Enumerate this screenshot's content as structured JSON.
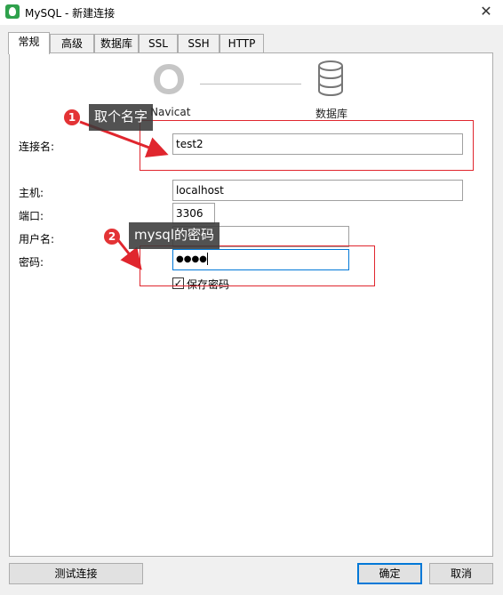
{
  "window": {
    "title": "MySQL - 新建连接",
    "close_glyph": "✕"
  },
  "tabs": [
    {
      "label": "常规",
      "active": true
    },
    {
      "label": "高级"
    },
    {
      "label": "数据库"
    },
    {
      "label": "SSL"
    },
    {
      "label": "SSH"
    },
    {
      "label": "HTTP"
    }
  ],
  "graphic": {
    "client_label": "Navicat",
    "server_label": "数据库",
    "client_icon": "navicat-icon",
    "server_icon": "database-icon"
  },
  "form": {
    "connection_name": {
      "label": "连接名:",
      "value": "test2"
    },
    "host": {
      "label": "主机:",
      "value": "localhost"
    },
    "port": {
      "label": "端口:",
      "value": "3306"
    },
    "username": {
      "label": "用户名:",
      "value": ""
    },
    "password": {
      "label": "密码:",
      "value": "●●●●"
    },
    "save_password": {
      "label": "保存密码",
      "checked": true,
      "check_glyph": "✓"
    }
  },
  "annotations": [
    {
      "number": "1",
      "text": "取个名字"
    },
    {
      "number": "2",
      "text": "mysql的密码"
    }
  ],
  "buttons": {
    "test": "测试连接",
    "ok": "确定",
    "cancel": "取消"
  },
  "colors": {
    "accent": "#0078d7",
    "annotation_red": "#e0262e",
    "callout_bg": "#3a3a3a"
  }
}
